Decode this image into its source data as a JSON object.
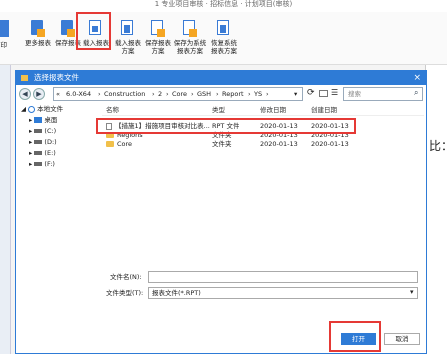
{
  "window_title": "1 专业项目审核 · 招标信息 · 计划项目(审核)",
  "ribbon": {
    "left_cut_label": "打印",
    "buttons": [
      {
        "label": "更多报表",
        "icon": "report-more-icon"
      },
      {
        "label": "保存报表",
        "icon": "save-report-icon"
      },
      {
        "label": "载入报表",
        "icon": "load-report-icon"
      },
      {
        "label": "载入报表\n方案",
        "icon": "load-scheme-icon"
      },
      {
        "label": "保存报表\n方案",
        "icon": "save-scheme-icon"
      },
      {
        "label": "保存为系统\n报表方案",
        "icon": "save-system-scheme-icon"
      },
      {
        "label": "恢复系统\n报表方案",
        "icon": "restore-system-scheme-icon"
      }
    ]
  },
  "dialog": {
    "title": "选择报表文件",
    "close": "×",
    "path": [
      "6.0-X64",
      "Construction",
      "2",
      "Core",
      "GSH",
      "Report",
      "YS"
    ],
    "search_placeholder": "搜索",
    "tree": [
      {
        "label": "本地文件",
        "level": 0
      },
      {
        "label": "桌面",
        "level": 1
      },
      {
        "label": "(C:)",
        "level": 1
      },
      {
        "label": "(D:)",
        "level": 1
      },
      {
        "label": "(E:)",
        "level": 1
      },
      {
        "label": "(F:)",
        "level": 1
      }
    ],
    "columns": {
      "name": "名称",
      "type": "类型",
      "modified": "修改日期",
      "created": "创建日期"
    },
    "files": [
      {
        "name": "【措施1】措施项目审核对比表...",
        "type": "RPT 文件",
        "modified": "2020-01-13",
        "created": "2020-01-13",
        "kind": "file"
      },
      {
        "name": "Regions",
        "type": "文件夹",
        "modified": "2020-01-13",
        "created": "2020-01-13",
        "kind": "folder"
      },
      {
        "name": "Core",
        "type": "文件夹",
        "modified": "2020-01-13",
        "created": "2020-01-13",
        "kind": "folder"
      }
    ],
    "filename_label": "文件名(N):",
    "filename_value": "",
    "filetype_label": "文件类型(T):",
    "filetype_value": "报表文件(*.RPT)",
    "open_label": "打开",
    "cancel_label": "取消"
  },
  "background_doc": {
    "fragment": "比："
  },
  "highlight_color": "#e53935",
  "accent_color": "#2e7bd6"
}
